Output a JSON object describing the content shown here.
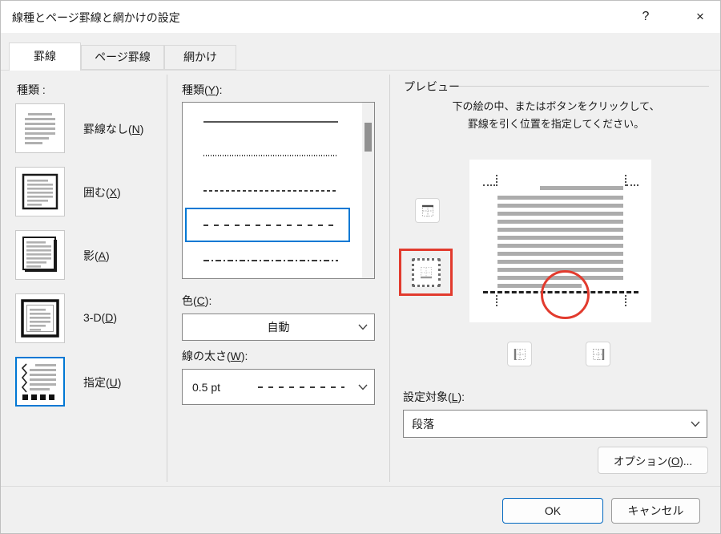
{
  "dialog": {
    "title": "線種とページ罫線と網かけの設定",
    "help_label": "?",
    "close_label": "×"
  },
  "tabs": [
    {
      "label": "罫線",
      "active": true
    },
    {
      "label": "ページ罫線",
      "active": false
    },
    {
      "label": "網かけ",
      "active": false
    }
  ],
  "presets": {
    "label": "種類 :",
    "options": [
      {
        "label": "罫線なし(N)",
        "icon": "border-none-icon",
        "selected": false
      },
      {
        "label": "囲む(X)",
        "icon": "border-box-icon",
        "selected": false
      },
      {
        "label": "影(A)",
        "icon": "border-shadow-icon",
        "selected": false
      },
      {
        "label": "3-D(D)",
        "icon": "border-3d-icon",
        "selected": false
      },
      {
        "label": "指定(U)",
        "icon": "border-custom-icon",
        "selected": true
      }
    ]
  },
  "line_style": {
    "label": "種類(Y):",
    "options": [
      "solid",
      "dotted",
      "dash-small",
      "dash-medium",
      "dash-dot"
    ],
    "selected_index": 3
  },
  "color": {
    "label": "色(C):",
    "value": "自動"
  },
  "line_width": {
    "label": "線の太さ(W):",
    "value": "0.5 pt",
    "sample_style": "dash-medium"
  },
  "preview": {
    "label": "プレビュー",
    "instructions": [
      "下の絵の中、またはボタンをクリックして、",
      "罫線を引く位置を指定してください。"
    ],
    "border_buttons": [
      {
        "name": "top-border",
        "pressed": false
      },
      {
        "name": "bottom-border",
        "pressed": true
      },
      {
        "name": "left-border",
        "pressed": false
      },
      {
        "name": "right-border",
        "pressed": false
      }
    ]
  },
  "apply_to": {
    "label": "設定対象(L):",
    "value": "段落"
  },
  "options_button": {
    "label": "オプション(O)..."
  },
  "footer": {
    "ok_label": "OK",
    "cancel_label": "キャンセル"
  },
  "colors": {
    "accent": "#0078d4",
    "annotation": "#e23b2e",
    "input_border": "#868686"
  }
}
